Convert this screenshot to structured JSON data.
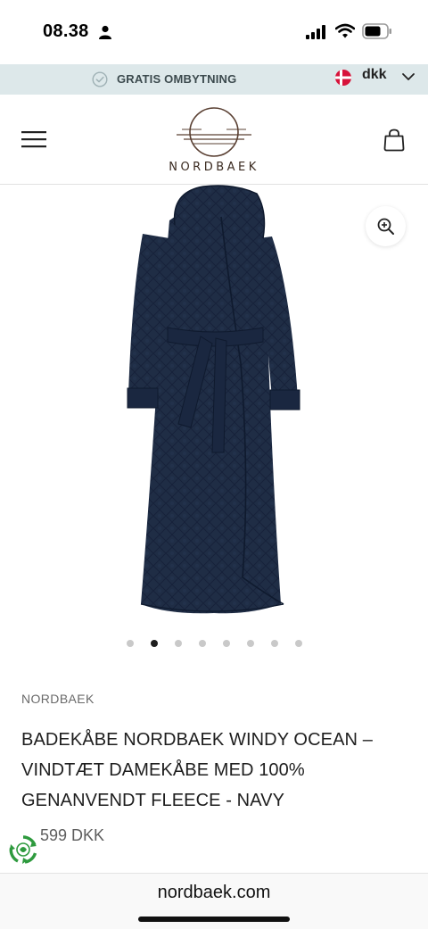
{
  "status_bar": {
    "time": "08.38",
    "icons": [
      "person-icon",
      "cellular-signal-icon",
      "wifi-icon",
      "battery-icon"
    ]
  },
  "announcement": {
    "text": "GRATIS OMBYTNING",
    "icon": "check-circle-icon",
    "currency": "dkk",
    "flag": "denmark-flag-icon"
  },
  "header": {
    "logo_text": "NORDBAEK",
    "icons": [
      "menu-icon",
      "logo-mark-icon",
      "shopping-bag-icon"
    ]
  },
  "gallery": {
    "image": "navy-quilted-bathrobe",
    "zoom_icon": "zoom-in-icon",
    "slide_count": 8,
    "active_slide": 2
  },
  "product": {
    "vendor": "NORDBAEK",
    "title": "BADEKÅBE NORDBAEK WINDY OCEAN – VINDTÆT DAMEKÅBE MED 100% GENANVENDT FLEECE - NAVY",
    "price": "599 DKK"
  },
  "floating_badge": {
    "icon": "recycle-badge-icon"
  },
  "browser": {
    "url": "nordbaek.com"
  },
  "colors": {
    "announce_bg": "#dde8ea",
    "coat": "#1f2d45",
    "text": "#1e1e1e"
  }
}
